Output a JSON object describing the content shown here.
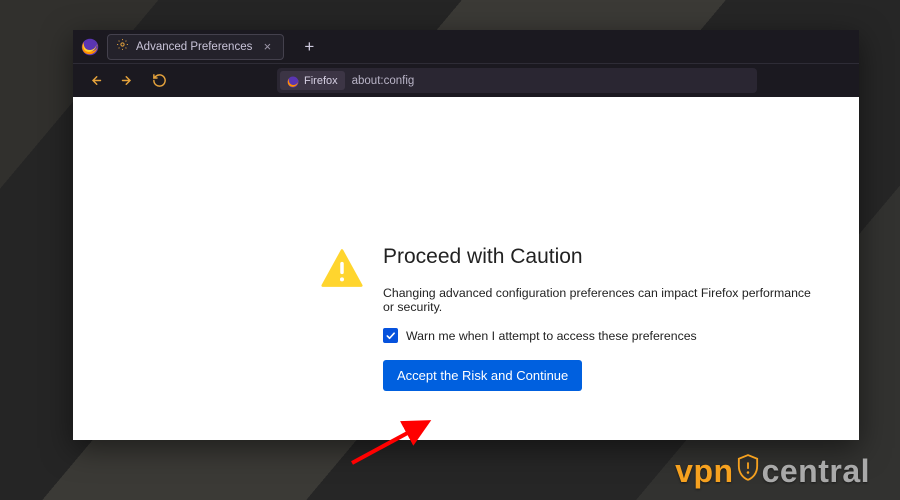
{
  "tab": {
    "title": "Advanced Preferences"
  },
  "url_bar": {
    "badge_text": "Firefox",
    "url_text": "about:config"
  },
  "page": {
    "title": "Proceed with Caution",
    "body": "Changing advanced configuration preferences can impact Firefox performance or security.",
    "checkbox_label": "Warn me when I attempt to access these preferences",
    "accept_label": "Accept the Risk and Continue"
  },
  "watermark": {
    "left": "vpn",
    "right": "central"
  }
}
